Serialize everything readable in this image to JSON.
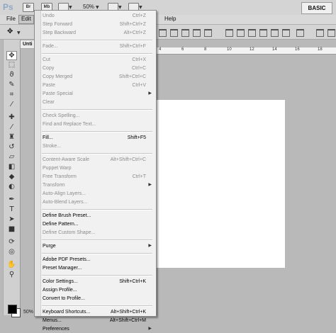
{
  "app": {
    "logo": "Ps",
    "bridge_label": "Br",
    "minibridge_label": "Mb",
    "zoom": "50%",
    "workspace": "BASIC"
  },
  "menubar": {
    "items": [
      {
        "label": "File",
        "active": false
      },
      {
        "label": "Edit",
        "active": true
      },
      {
        "label": "Help",
        "active": false
      }
    ]
  },
  "document": {
    "tab_label": "Unti",
    "status_zoom": "50%",
    "ruler_numbers": [
      "4",
      "6",
      "8",
      "10",
      "12",
      "14",
      "16",
      "18"
    ]
  },
  "colors": {
    "foreground": "#000000",
    "background": "#ffffff"
  },
  "edit_menu": {
    "items": [
      {
        "label": "Undo",
        "shortcut": "Ctrl+Z",
        "disabled": true
      },
      {
        "label": "Step Forward",
        "shortcut": "Shift+Ctrl+Z",
        "disabled": true
      },
      {
        "label": "Step Backward",
        "shortcut": "Alt+Ctrl+Z",
        "disabled": true
      },
      {
        "sep": true
      },
      {
        "label": "Fade...",
        "shortcut": "Shift+Ctrl+F",
        "disabled": true
      },
      {
        "sep": true
      },
      {
        "label": "Cut",
        "shortcut": "Ctrl+X",
        "disabled": true
      },
      {
        "label": "Copy",
        "shortcut": "Ctrl+C",
        "disabled": true
      },
      {
        "label": "Copy Merged",
        "shortcut": "Shift+Ctrl+C",
        "disabled": true
      },
      {
        "label": "Paste",
        "shortcut": "Ctrl+V",
        "disabled": true
      },
      {
        "label": "Paste Special",
        "shortcut": "",
        "disabled": true,
        "submenu": true
      },
      {
        "label": "Clear",
        "shortcut": "",
        "disabled": true
      },
      {
        "sep": true
      },
      {
        "label": "Check Spelling...",
        "shortcut": "",
        "disabled": true
      },
      {
        "label": "Find and Replace Text...",
        "shortcut": "",
        "disabled": true
      },
      {
        "sep": true
      },
      {
        "label": "Fill...",
        "shortcut": "Shift+F5",
        "disabled": false
      },
      {
        "label": "Stroke...",
        "shortcut": "",
        "disabled": true
      },
      {
        "sep": true
      },
      {
        "label": "Content-Aware Scale",
        "shortcut": "Alt+Shift+Ctrl+C",
        "disabled": true
      },
      {
        "label": "Puppet Warp",
        "shortcut": "",
        "disabled": true
      },
      {
        "label": "Free Transform",
        "shortcut": "Ctrl+T",
        "disabled": true
      },
      {
        "label": "Transform",
        "shortcut": "",
        "disabled": true,
        "submenu": true
      },
      {
        "label": "Auto-Align Layers...",
        "shortcut": "",
        "disabled": true
      },
      {
        "label": "Auto-Blend Layers...",
        "shortcut": "",
        "disabled": true
      },
      {
        "sep": true
      },
      {
        "label": "Define Brush Preset...",
        "shortcut": "",
        "disabled": false
      },
      {
        "label": "Define Pattern...",
        "shortcut": "",
        "disabled": false
      },
      {
        "label": "Define Custom Shape...",
        "shortcut": "",
        "disabled": true
      },
      {
        "sep": true
      },
      {
        "label": "Purge",
        "shortcut": "",
        "disabled": false,
        "submenu": true
      },
      {
        "sep": true
      },
      {
        "label": "Adobe PDF Presets...",
        "shortcut": "",
        "disabled": false
      },
      {
        "label": "Preset Manager...",
        "shortcut": "",
        "disabled": false
      },
      {
        "sep": true
      },
      {
        "label": "Color Settings...",
        "shortcut": "Shift+Ctrl+K",
        "disabled": false
      },
      {
        "label": "Assign Profile...",
        "shortcut": "",
        "disabled": false
      },
      {
        "label": "Convert to Profile...",
        "shortcut": "",
        "disabled": false
      },
      {
        "sep": true
      },
      {
        "label": "Keyboard Shortcuts...",
        "shortcut": "Alt+Shift+Ctrl+K",
        "disabled": false
      },
      {
        "label": "Menus...",
        "shortcut": "Alt+Shift+Ctrl+M",
        "disabled": false
      },
      {
        "label": "Preferences",
        "shortcut": "",
        "disabled": false,
        "submenu": true
      }
    ]
  },
  "tools": [
    "move-tool-icon",
    "marquee-tool-icon",
    "lasso-tool-icon",
    "quick-select-tool-icon",
    "crop-tool-icon",
    "eyedropper-tool-icon",
    "healing-brush-tool-icon",
    "brush-tool-icon",
    "clone-stamp-tool-icon",
    "history-brush-tool-icon",
    "eraser-tool-icon",
    "gradient-tool-icon",
    "blur-tool-icon",
    "dodge-tool-icon",
    "pen-tool-icon",
    "type-tool-icon",
    "path-select-tool-icon",
    "rectangle-tool-icon",
    "3d-rotate-tool-icon",
    "3d-orbit-tool-icon",
    "hand-tool-icon",
    "zoom-tool-icon"
  ]
}
